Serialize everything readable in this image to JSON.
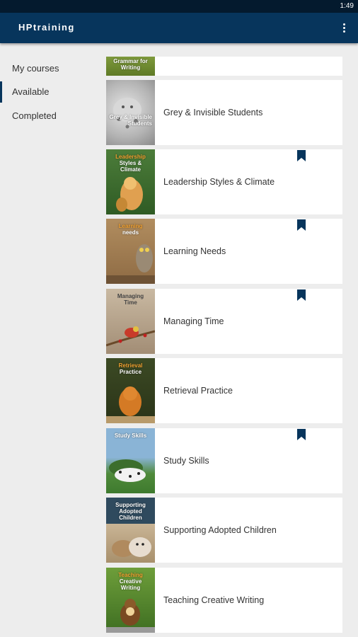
{
  "status_bar": {
    "time": "1:49"
  },
  "app_bar": {
    "title": "HPtraining",
    "menu_icon": "more-vert-icon"
  },
  "sidebar": {
    "items": [
      {
        "label": "My courses",
        "active": false
      },
      {
        "label": "Available",
        "active": true
      },
      {
        "label": "Completed",
        "active": false
      }
    ]
  },
  "colors": {
    "app_bar": "#07355c",
    "status_bar": "#041a2e",
    "background": "#ededed",
    "bookmark": "#07355c"
  },
  "courses": [
    {
      "name": "",
      "cover_title": "Grammar for Writing",
      "bookmarked": false
    },
    {
      "name": "Grey & Invisible Students",
      "cover_title": "Grey & Invisible Students",
      "bookmarked": false
    },
    {
      "name": "Leadership Styles & Climate",
      "cover_title": "Leadership Styles & Climate",
      "bookmarked": true
    },
    {
      "name": "Learning Needs",
      "cover_title": "Learning Needs",
      "bookmarked": true
    },
    {
      "name": "Managing Time",
      "cover_title": "Managing Time",
      "bookmarked": true
    },
    {
      "name": "Retrieval Practice",
      "cover_title": "Retrieval Practice",
      "bookmarked": false
    },
    {
      "name": "Study Skills",
      "cover_title": "Study Skills",
      "bookmarked": true
    },
    {
      "name": "Supporting Adopted Children",
      "cover_title": "Supporting Adopted Children",
      "bookmarked": false
    },
    {
      "name": "Teaching Creative Writing",
      "cover_title": "Teaching Creative Writing",
      "bookmarked": false
    }
  ]
}
